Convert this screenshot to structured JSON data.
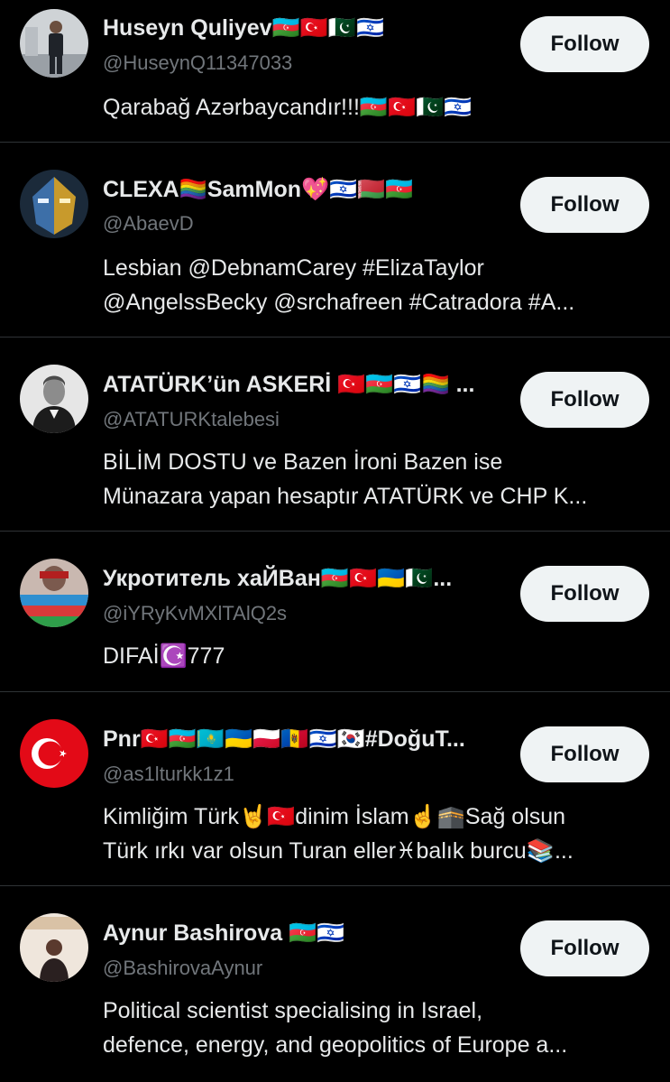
{
  "follow_label": "Follow",
  "users": [
    {
      "name": "Huseyn Quliyev🇦🇿🇹🇷🇵🇰🇮🇱",
      "handle": "@HuseynQ11347033",
      "bio": [
        "Qarabağ Azərbaycandır!!!🇦🇿🇹🇷🇵🇰🇮🇱"
      ],
      "avatar_icon": "man-standing-avatar"
    },
    {
      "name": "CLEXA🏳️‍🌈SamMon💖🇮🇱🇧🇾🇦🇿",
      "handle": "@AbaevD",
      "bio": [
        "Lesbian @DebnamCarey #ElizaTaylor",
        "@AngelssBecky @srchafreen #Catradora #A..."
      ],
      "avatar_icon": "masked-fighter-avatar"
    },
    {
      "name": "ATATÜRK’ün ASKERİ 🇹🇷🇦🇿🇮🇱🏳️‍🌈 ...",
      "handle": "@ATATURKtalebesi",
      "bio": [
        "BİLİM DOSTU ve Bazen İroni Bazen ise",
        "Münazara yapan hesaptır ATATÜRK ve CHP K..."
      ],
      "avatar_icon": "portrait-avatar"
    },
    {
      "name": "Укротитель хаЙВан🇦🇿🇹🇷🇺🇦🇵🇰...",
      "handle": "@iYRyKvMXlTAlQ2s",
      "bio": [
        "DIFAİ☪️777"
      ],
      "avatar_icon": "flag-person-avatar"
    },
    {
      "name": "Pnr🇹🇷🇦🇿🇰🇿🇺🇦🇵🇱🇲🇩🇮🇱🇰🇷#DoğuT...",
      "handle": "@as1lturkk1z1",
      "bio": [
        "Kimliğim Türk🤘🇹🇷dinim İslam☝️🕋Sağ olsun",
        "Türk ırkı var olsun Turan eller♓balık burcu📚..."
      ],
      "avatar_icon": "turkish-flag-avatar"
    },
    {
      "name": "Aynur Bashirova 🇦🇿🇮🇱",
      "handle": "@BashirovaAynur",
      "bio": [
        "Political scientist specialising in Israel,",
        "defence, energy, and geopolitics of Europe a..."
      ],
      "avatar_icon": "woman-speaker-avatar"
    }
  ]
}
